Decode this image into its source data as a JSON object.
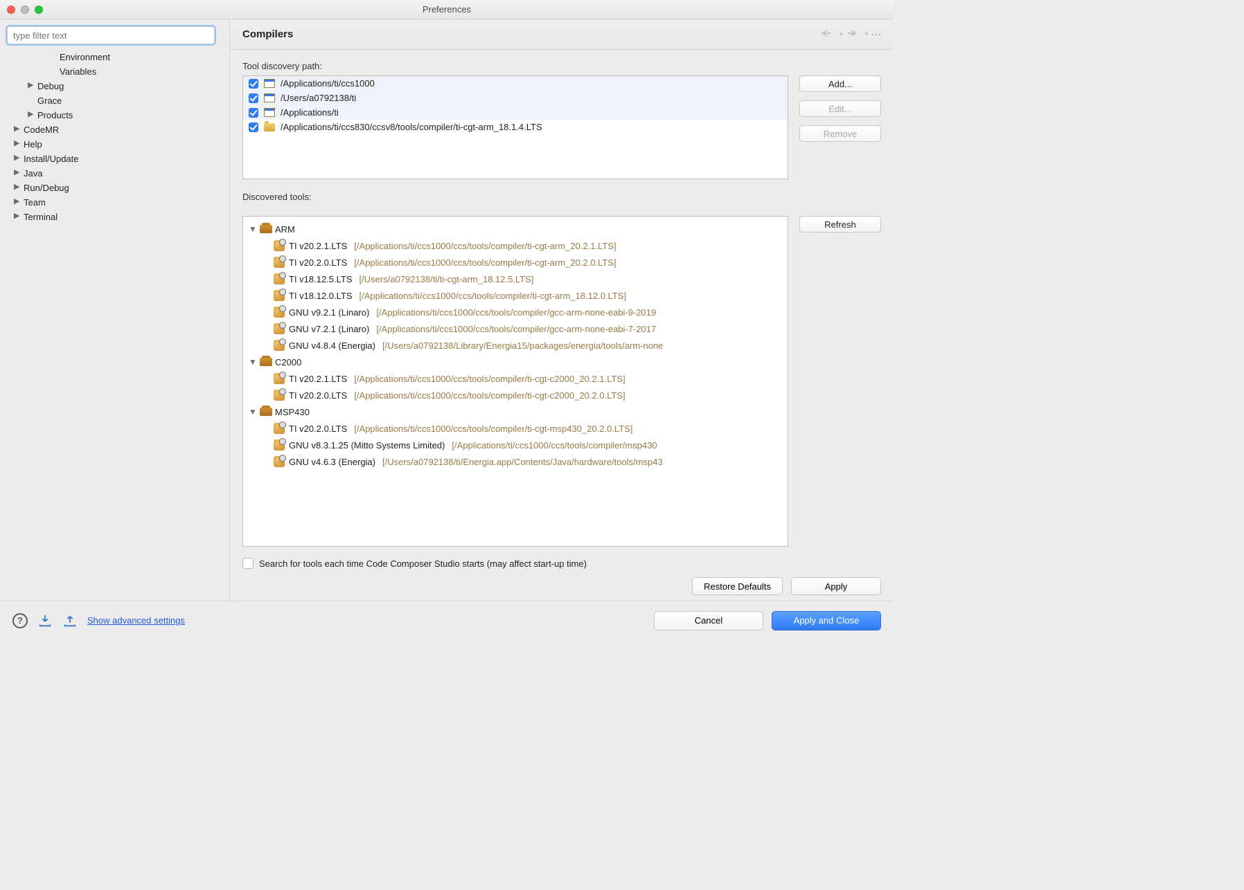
{
  "window": {
    "title": "Preferences"
  },
  "sidebar": {
    "filter_placeholder": "type filter text",
    "items": [
      {
        "indent": 2,
        "arrow": false,
        "label": "Environment"
      },
      {
        "indent": 2,
        "arrow": false,
        "label": "Variables"
      },
      {
        "indent": 1,
        "arrow": true,
        "label": "Debug"
      },
      {
        "indent": 1,
        "arrow": false,
        "label": "Grace"
      },
      {
        "indent": 1,
        "arrow": true,
        "label": "Products"
      },
      {
        "indent": 0,
        "arrow": true,
        "label": "CodeMR"
      },
      {
        "indent": 0,
        "arrow": true,
        "label": "Help"
      },
      {
        "indent": 0,
        "arrow": true,
        "label": "Install/Update"
      },
      {
        "indent": 0,
        "arrow": true,
        "label": "Java"
      },
      {
        "indent": 0,
        "arrow": true,
        "label": "Run/Debug"
      },
      {
        "indent": 0,
        "arrow": true,
        "label": "Team"
      },
      {
        "indent": 0,
        "arrow": true,
        "label": "Terminal"
      }
    ]
  },
  "main": {
    "title": "Compilers",
    "tool_discovery_label": "Tool discovery path:",
    "discovered_label": "Discovered tools:",
    "paths": [
      {
        "checked": true,
        "icon": "disk",
        "path": "/Applications/ti/ccs1000",
        "selected": true
      },
      {
        "checked": true,
        "icon": "disk",
        "path": "/Users/a0792138/ti",
        "selected": true
      },
      {
        "checked": true,
        "icon": "disk",
        "path": "/Applications/ti",
        "selected": true
      },
      {
        "checked": true,
        "icon": "folder",
        "path": "/Applications/ti/ccs830/ccsv8/tools/compiler/ti-cgt-arm_18.1.4.LTS",
        "selected": false
      }
    ],
    "path_buttons": {
      "add": "Add...",
      "edit": "Edit...",
      "remove": "Remove"
    },
    "refresh": "Refresh",
    "groups": [
      {
        "name": "ARM",
        "tools": [
          {
            "name": "TI v20.2.1.LTS",
            "path": "[/Applications/ti/ccs1000/ccs/tools/compiler/ti-cgt-arm_20.2.1.LTS]"
          },
          {
            "name": "TI v20.2.0.LTS",
            "path": "[/Applications/ti/ccs1000/ccs/tools/compiler/ti-cgt-arm_20.2.0.LTS]"
          },
          {
            "name": "TI v18.12.5.LTS",
            "path": "[/Users/a0792138/ti/ti-cgt-arm_18.12.5.LTS]"
          },
          {
            "name": "TI v18.12.0.LTS",
            "path": "[/Applications/ti/ccs1000/ccs/tools/compiler/ti-cgt-arm_18.12.0.LTS]"
          },
          {
            "name": "GNU v9.2.1 (Linaro)",
            "path": "[/Applications/ti/ccs1000/ccs/tools/compiler/gcc-arm-none-eabi-9-2019"
          },
          {
            "name": "GNU v7.2.1 (Linaro)",
            "path": "[/Applications/ti/ccs1000/ccs/tools/compiler/gcc-arm-none-eabi-7-2017"
          },
          {
            "name": "GNU v4.8.4 (Energia)",
            "path": "[/Users/a0792138/Library/Energia15/packages/energia/tools/arm-none"
          }
        ]
      },
      {
        "name": "C2000",
        "tools": [
          {
            "name": "TI v20.2.1.LTS",
            "path": "[/Applications/ti/ccs1000/ccs/tools/compiler/ti-cgt-c2000_20.2.1.LTS]"
          },
          {
            "name": "TI v20.2.0.LTS",
            "path": "[/Applications/ti/ccs1000/ccs/tools/compiler/ti-cgt-c2000_20.2.0.LTS]"
          }
        ]
      },
      {
        "name": "MSP430",
        "tools": [
          {
            "name": "TI v20.2.0.LTS",
            "path": "[/Applications/ti/ccs1000/ccs/tools/compiler/ti-cgt-msp430_20.2.0.LTS]"
          },
          {
            "name": "GNU v8.3.1.25 (Mitto Systems Limited)",
            "path": "[/Applications/ti/ccs1000/ccs/tools/compiler/msp430"
          },
          {
            "name": "GNU v4.6.3 (Energia)",
            "path": "[/Users/a0792138/ti/Energia.app/Contents/Java/hardware/tools/msp43"
          }
        ]
      }
    ],
    "search_label": "Search for tools each time Code Composer Studio starts (may affect start-up time)",
    "restore": "Restore Defaults",
    "apply": "Apply"
  },
  "footer": {
    "advanced_link": "Show advanced settings",
    "cancel": "Cancel",
    "apply_close": "Apply and Close"
  }
}
